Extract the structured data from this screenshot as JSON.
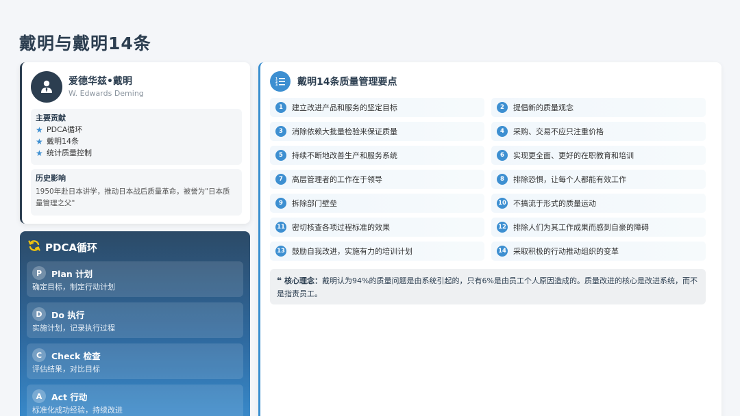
{
  "page": {
    "title": "戴明与戴明14条"
  },
  "profile": {
    "name_cn": "爱德华兹•戴明",
    "name_en": "W. Edwards Deming",
    "contributions_title": "主要贡献",
    "contributions": [
      "PDCA循环",
      "戴明14条",
      "统计质量控制"
    ],
    "history_title": "历史影响",
    "history_text": "1950年赴日本讲学，推动日本战后质量革命，被誉为\"日本质量管理之父\""
  },
  "pdca": {
    "title": "PDCA循环",
    "steps": [
      {
        "badge": "P",
        "name": "Plan 计划",
        "desc": "确定目标，制定行动计划"
      },
      {
        "badge": "D",
        "name": "Do 执行",
        "desc": "实施计划，记录执行过程"
      },
      {
        "badge": "C",
        "name": "Check 检查",
        "desc": "评估结果，对比目标"
      },
      {
        "badge": "A",
        "name": "Act 行动",
        "desc": "标准化成功经验，持续改进"
      }
    ]
  },
  "points": {
    "title": "戴明14条质量管理要点",
    "items": [
      {
        "num": "1",
        "text": "建立改进产品和服务的坚定目标"
      },
      {
        "num": "2",
        "text": "提倡新的质量观念"
      },
      {
        "num": "3",
        "text": "消除依赖大批量检验来保证质量"
      },
      {
        "num": "4",
        "text": "采购、交易不应只注重价格"
      },
      {
        "num": "5",
        "text": "持续不断地改善生产和服务系统"
      },
      {
        "num": "6",
        "text": "实现更全面、更好的在职教育和培训"
      },
      {
        "num": "7",
        "text": "高层管理者的工作在于领导"
      },
      {
        "num": "8",
        "text": "排除恐惧，让每个人都能有效工作"
      },
      {
        "num": "9",
        "text": "拆除部门壁垒"
      },
      {
        "num": "10",
        "text": "不搞流于形式的质量运动"
      },
      {
        "num": "11",
        "text": "密切核查各项过程标准的效果"
      },
      {
        "num": "12",
        "text": "排除人们为其工作成果而感到自豪的障碍"
      },
      {
        "num": "13",
        "text": "鼓励自我改进，实施有力的培训计划"
      },
      {
        "num": "14",
        "text": "采取积极的行动推动组织的变革"
      }
    ],
    "core_label": "核心理念：",
    "core_text": "戴明认为94%的质量问题是由系统引起的，只有6%是由员工个人原因造成的。质量改进的核心是改进系统，而不是指责员工。"
  },
  "icons": {
    "avatar": "user-tie-icon",
    "star": "star-icon",
    "pdca": "sync-icon",
    "list": "list-ol-icon",
    "quote": "quote-left-icon"
  },
  "colors": {
    "primary_dark": "#2c3e50",
    "accent_blue": "#3d8fd1",
    "pdca_icon": "#f1c40f"
  }
}
